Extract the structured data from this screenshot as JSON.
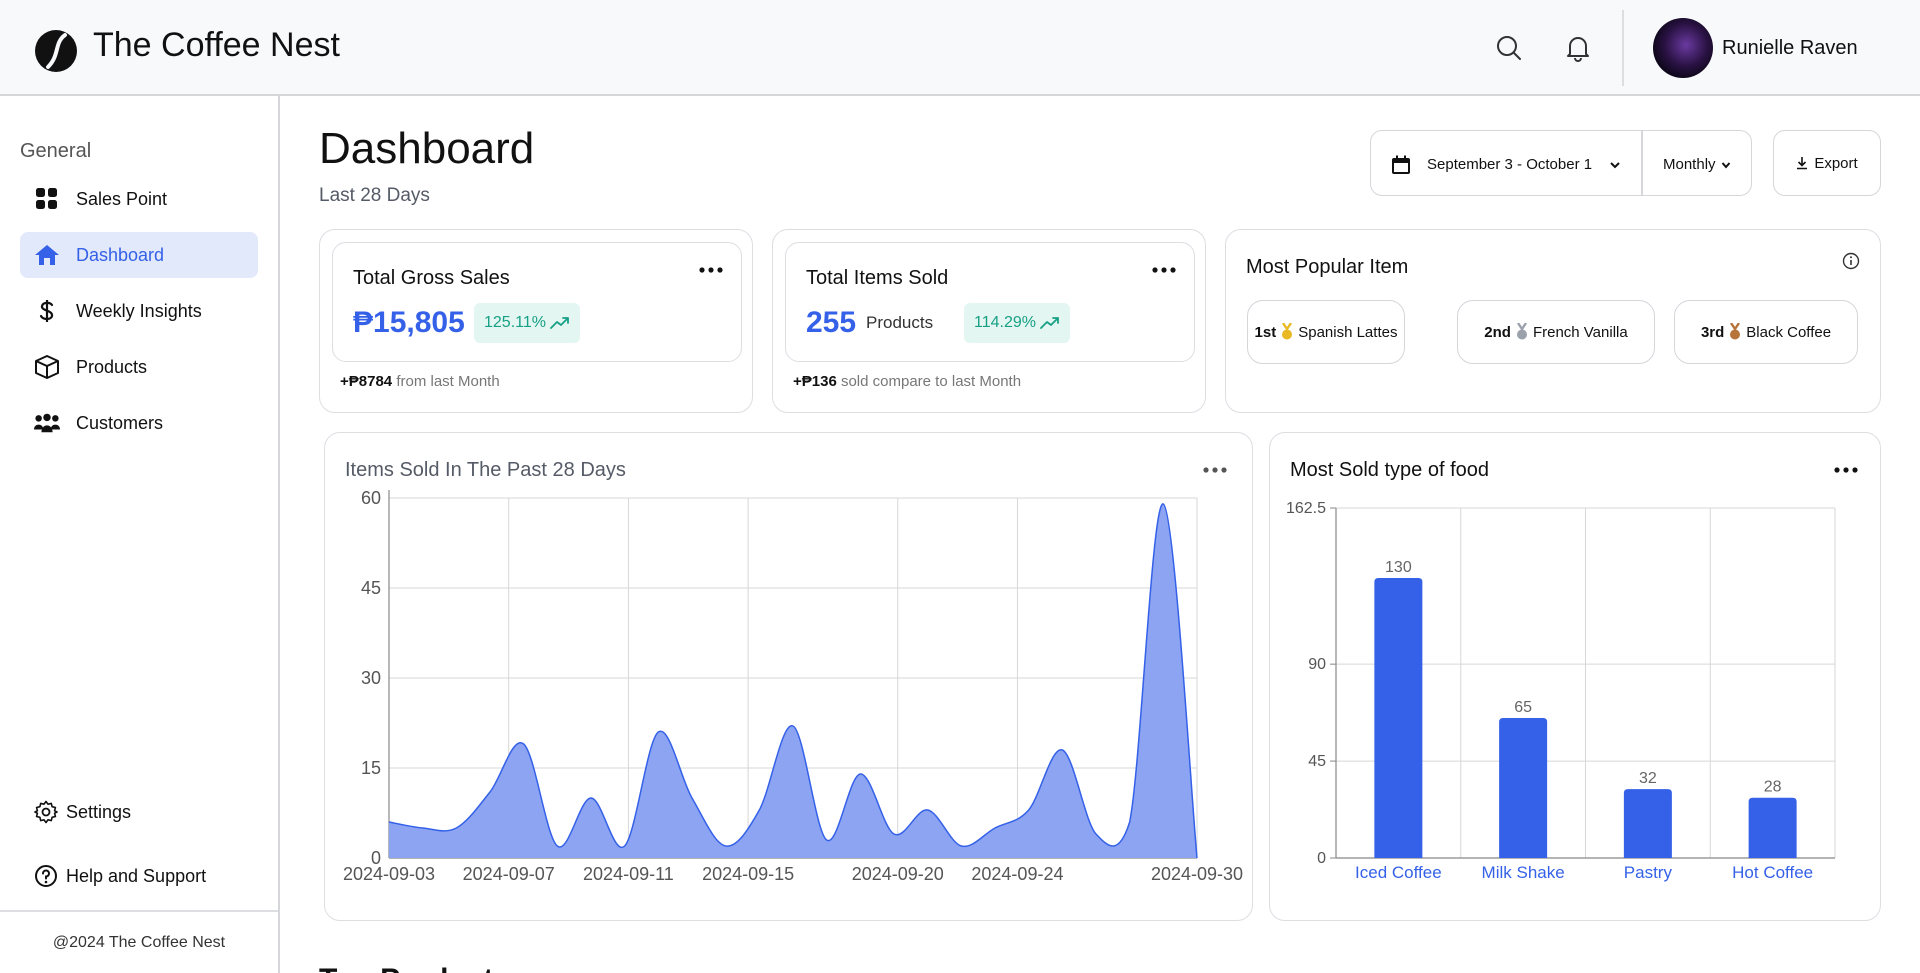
{
  "header": {
    "brand": "The Coffee Nest",
    "user_name": "Runielle Raven"
  },
  "sidebar": {
    "group_label": "General",
    "items": [
      {
        "label": "Sales Point",
        "icon": "grid-icon"
      },
      {
        "label": "Dashboard",
        "icon": "home-icon",
        "active": true
      },
      {
        "label": "Weekly Insights",
        "icon": "dollar-icon"
      },
      {
        "label": "Products",
        "icon": "box-icon"
      },
      {
        "label": "Customers",
        "icon": "users-icon"
      }
    ],
    "settings_label": "Settings",
    "help_label": "Help and Support",
    "copyright": "@2024 The Coffee Nest"
  },
  "main": {
    "title": "Dashboard",
    "subtitle": "Last 28 Days",
    "date_range": "September 3 - October 1",
    "period": "Monthly",
    "export_label": "Export",
    "section_peek": "Top Products"
  },
  "kpis": {
    "gross_sales": {
      "title": "Total Gross Sales",
      "value": "₱15,805",
      "change": "125.11%",
      "foot_value": "+₱8784",
      "foot_text": "from last Month"
    },
    "items_sold": {
      "title": "Total Items Sold",
      "value": "255",
      "unit": "Products",
      "change": "114.29%",
      "foot_value": "+₱136",
      "foot_text": "sold compare to last Month"
    }
  },
  "popular": {
    "title": "Most Popular Item",
    "items": [
      {
        "rank": "1st",
        "name": "Spanish Lattes",
        "medal": "#e8b923"
      },
      {
        "rank": "2nd",
        "name": "French Vanilla",
        "medal": "#9aa1ab"
      },
      {
        "rank": "3rd",
        "name": "Black Coffee",
        "medal": "#b8733a"
      }
    ]
  },
  "colors": {
    "accent": "#3461e8",
    "area_fill": "#8aa2f2",
    "positive": "#16a085",
    "positive_bg": "#e4f6f1"
  },
  "chart_data": [
    {
      "type": "area",
      "title": "Items Sold In The Past 28 Days",
      "x": [
        "2024-09-03",
        "2024-09-04",
        "2024-09-05",
        "2024-09-06",
        "2024-09-07",
        "2024-09-08",
        "2024-09-09",
        "2024-09-10",
        "2024-09-11",
        "2024-09-12",
        "2024-09-13",
        "2024-09-14",
        "2024-09-15",
        "2024-09-16",
        "2024-09-17",
        "2024-09-18",
        "2024-09-19",
        "2024-09-20",
        "2024-09-21",
        "2024-09-22",
        "2024-09-23",
        "2024-09-24",
        "2024-09-25",
        "2024-09-26",
        "2024-09-27",
        "2024-09-28",
        "2024-09-29",
        "2024-09-30"
      ],
      "values": [
        6,
        5,
        5,
        11,
        19,
        2,
        10,
        2,
        21,
        10,
        2,
        8,
        22,
        3,
        14,
        4,
        8,
        2,
        5,
        8,
        18,
        4,
        6,
        59,
        0
      ],
      "tick_labels": [
        "2024-09-03",
        "2024-09-07",
        "2024-09-11",
        "2024-09-15",
        "2024-09-20",
        "2024-09-24",
        "2024-09-30"
      ],
      "yticks": [
        0,
        15,
        30,
        45,
        60
      ],
      "ylim": [
        0,
        60
      ],
      "grid": true
    },
    {
      "type": "bar",
      "title": "Most Sold type of food",
      "categories": [
        "Iced Coffee",
        "Milk Shake",
        "Pastry",
        "Hot Coffee"
      ],
      "values": [
        130,
        65,
        32,
        28
      ],
      "yticks": [
        0,
        45,
        90,
        162.5
      ],
      "ylim": [
        0,
        162.5
      ],
      "grid": true
    }
  ]
}
